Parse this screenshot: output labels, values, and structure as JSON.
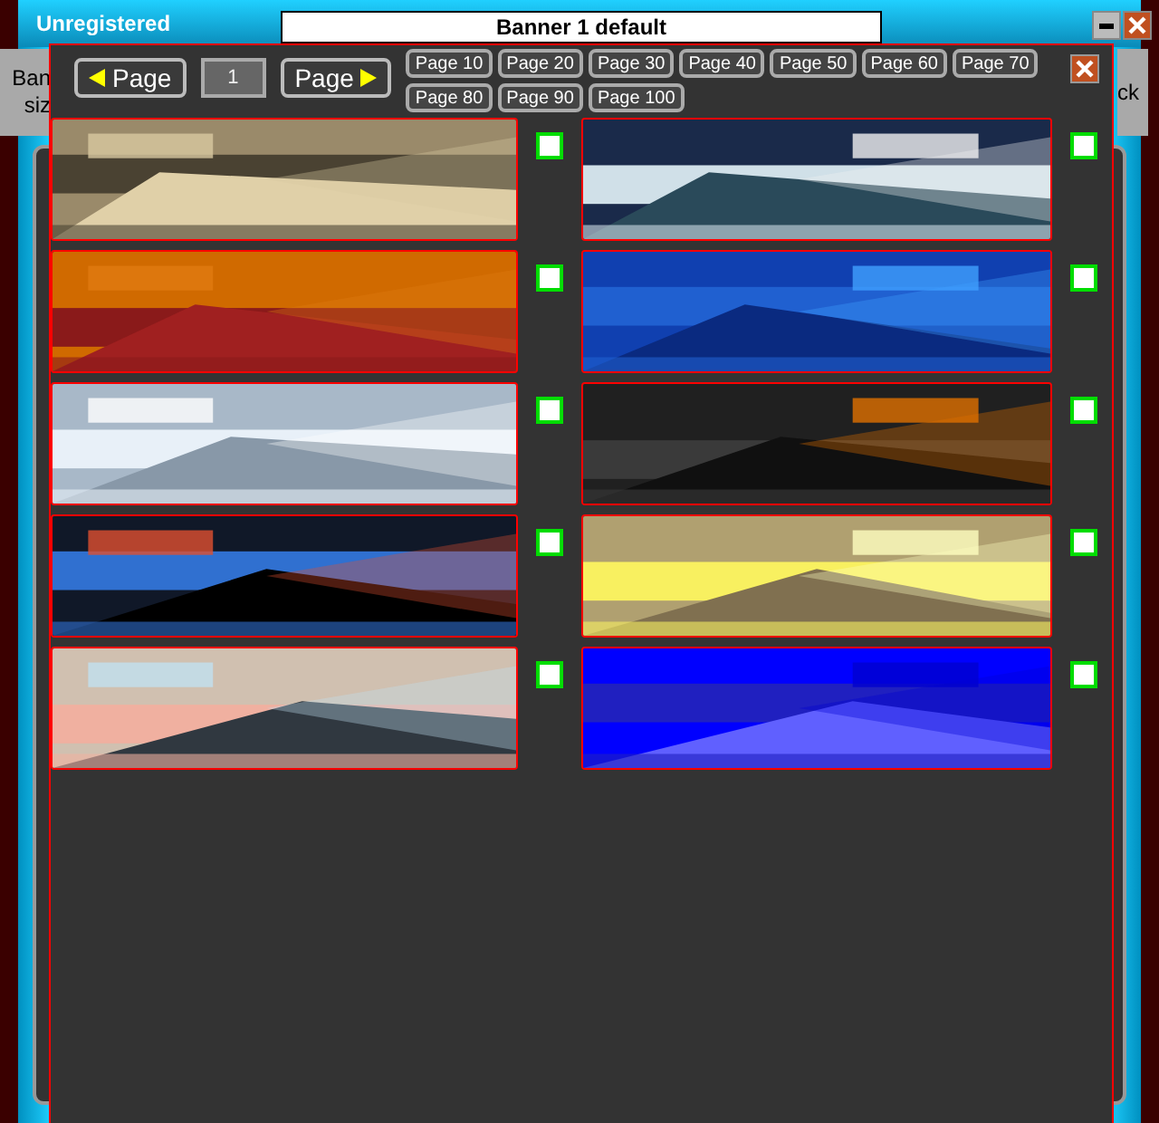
{
  "window": {
    "title": "Unregistered",
    "banner_name": "Banner 1 default"
  },
  "background": {
    "left_label_lines": [
      "Ban",
      "siz"
    ],
    "right_label": "ck"
  },
  "picker": {
    "prev_label": "Page",
    "page_number": "1",
    "next_label": "Page",
    "page_buttons": [
      "Page 10",
      "Page 20",
      "Page 30",
      "Page 40",
      "Page 50",
      "Page 60",
      "Page 70",
      "Page 80",
      "Page 90",
      "Page 100"
    ],
    "items": [
      {
        "checked": false
      },
      {
        "checked": false
      },
      {
        "checked": false
      },
      {
        "checked": false
      },
      {
        "checked": false
      },
      {
        "checked": false
      },
      {
        "checked": false
      },
      {
        "checked": false
      },
      {
        "checked": false
      },
      {
        "checked": false
      }
    ]
  }
}
